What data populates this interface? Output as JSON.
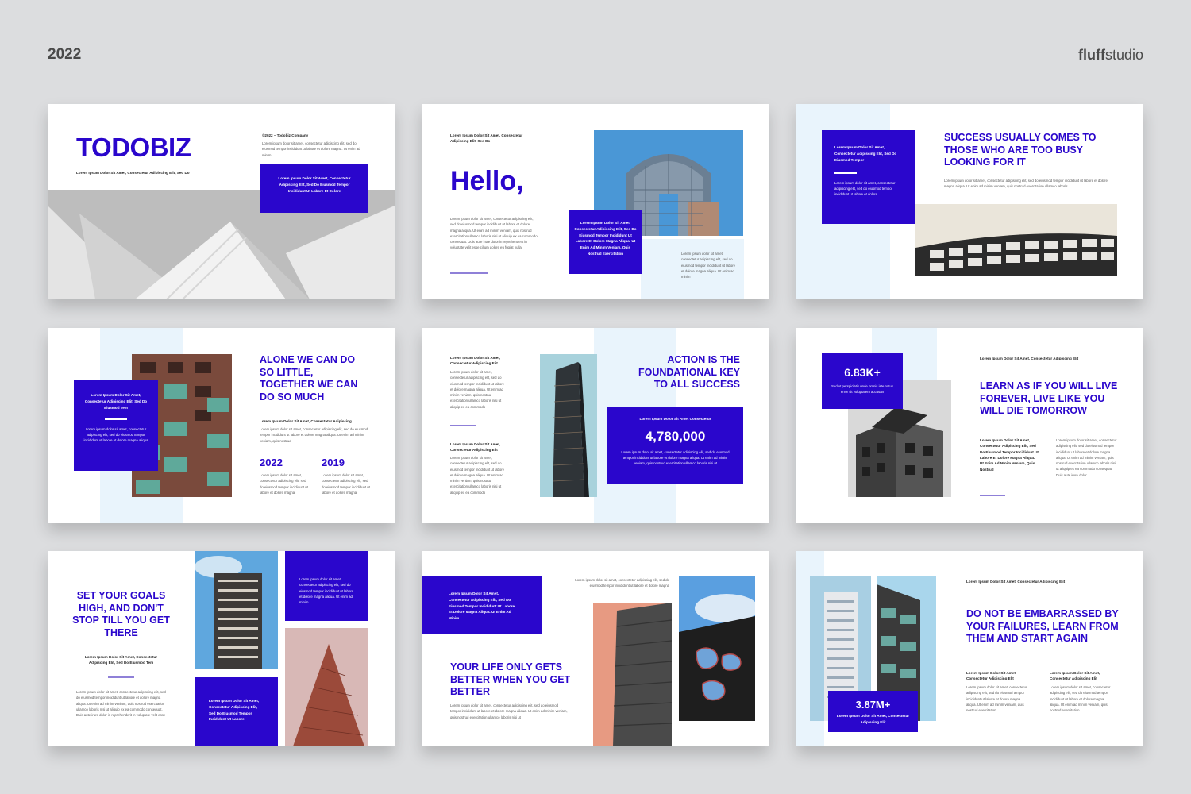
{
  "header": {
    "year": "2022",
    "brand_bold": "fluff",
    "brand_light": "studio"
  },
  "colors": {
    "accent": "#2a06cc",
    "tint": "#e9f4fc",
    "background": "#dcdddf"
  },
  "slides": {
    "s1": {
      "title": "TODOBIZ",
      "subtitle": "Lorem Ipsum Dolor Sit Amet, Consectetur Adipiscing Elit, Sed Do",
      "copyright": "©2022 – Todobiz Company",
      "body": "Lorem ipsum dolor sit amet, consectetur adipiscing elit, sed do eiusmod tempor incididunt ut labore et dolore magna. Ut enim ad minim",
      "box": "Lorem Ipsum Dolor Sit Amet, Consectetur Adipiscing Elit, Sed Do Eiusmod Tempor Incididunt Ut Labore Et Dolore"
    },
    "s2": {
      "kicker": "Lorem Ipsum Dolor Sit Amet, Consectetur Adipiscing Elit, Sed Do",
      "title": "Hello,",
      "body": "Lorem ipsum dolor sit amet, consectetur adipiscing elit, sed do eiusmod tempor incididunt ut labore et dolore magna aliqua. Ut enim ad minim veniam, quis nostrud exercitation ullamco laboris nisi ut aliquip ex ea commodo consequat. Duis aute irure dolor in reprehenderit in voluptate velit esse cillum dolore eu fugiat nulla.",
      "box": "Lorem Ipsum Dolor Sit Amet, Consectetur Adipiscing Elit, Sed Do Eiusmod Tempor Incididunt Ut Labore Et Dolore Magna Aliqua. Ut Enim Ad Minim Veniam, Quis Nostrud Exercitation",
      "side": "Lorem ipsum dolor sit amet, consectetur adipiscing elit, sed do eiusmod tempor incididunt ut labore et dolore magna aliqua. Ut enim ad minim"
    },
    "s3": {
      "box_title": "Lorem Ipsum Dolor Sit Amet, Consectetur Adipiscing Elit, Sed Do Eiusmod Tempor",
      "box_body": "Lorem ipsum dolor sit amet, consectetur adipiscing elit, sed do eiusmod tempor incididunt ut labore et dolore",
      "title": "SUCCESS USUALLY COMES TO THOSE WHO ARE TOO BUSY LOOKING FOR IT",
      "body": "Lorem ipsum dolor sit amet, consectetur adipiscing elit, sed do eiusmod tempor incididunt ut labore et dolore magna aliqua. Ut enim ad minim veniam, quis nostrud exercitation ullamco laboris"
    },
    "s4": {
      "box_title": "Lorem Ipsum Dolor Sit Amet, Consectetur Adipiscing Elit, Sed Do Eiusmod Tem",
      "box_body": "Lorem ipsum dolor sit amet, consectetur adipiscing elit, sed do eiusmod tempor incididunt ut labore et dolore magna aliqua",
      "title": "ALONE WE CAN DO SO LITTLE, TOGETHER WE CAN DO SO MUCH",
      "kicker": "Lorem Ipsum Dolor Sit Amet, Consectetur Adipiscing",
      "body": "Lorem ipsum dolor sit amet, consectetur adipiscing elit, sed do eiusmod tempor incididunt ut labore et dolore magna aliqua. Ut enim ad minim veniam, quis nostrud",
      "year1": "2022",
      "year2": "2019",
      "col1": "Lorem ipsum dolor sit amet, consectetur adipiscing elit, sed do eiusmod tempor incididunt ut labore et dolore magna",
      "col2": "Lorem ipsum dolor sit amet, consectetur adipiscing elit, sed do eiusmod tempor incididunt ut labore et dolore magna"
    },
    "s5": {
      "kicker1": "Lorem Ipsum Dolor Sit Amet, Consectetur Adipiscing Elit",
      "body1": "Lorem ipsum dolor sit amet, consectetur adipiscing elit, sed do eiusmod tempor incididunt ut labore et dolore magna aliqua. Ut enim ad minim veniam, quis nostrud exercitation ullamco laboris nisi ut aliquip ex ea commodo",
      "kicker2": "Lorem Ipsum Dolor Sit Amet, Consectetur Adipiscing Elit",
      "body2": "Lorem ipsum dolor sit amet, consectetur adipiscing elit, sed do eiusmod tempor incididunt ut labore et dolore magna aliqua. Ut enim ad minim veniam, quis nostrud exercitation ullamco laboris nisi ut aliquip ex ea commodo",
      "title": "ACTION IS THE FOUNDATIONAL KEY TO ALL SUCCESS",
      "box_kicker": "Lorem Ipsum Dolor Sit Amet Consectetur",
      "stat": "4,780,000",
      "box_body": "Lorem ipsum dolor sit amet, consectetur adipiscing elit, sed do eiusmod tempor incididunt ut labore et dolore magna aliqua. Ut enim ad minim veniam, quis nostrud exercitation ullamco laboris nisi ut"
    },
    "s6": {
      "stat": "6.83K+",
      "stat_caption": "Sed ut perspiciatis unde omnis iste natus error sit voluptatem accusan",
      "kicker": "Lorem Ipsum Dolor Sit Amet, Consectetur Adipiscing Elit",
      "title": "LEARN AS IF YOU WILL LIVE FOREVER, LIVE LIKE YOU WILL DIE TOMORROW",
      "col1": "Lorem Ipsum Dolor Sit Amet, Consectetur Adipiscing Elit, Sed Do Eiusmod Tempor Incididunt Ut Labore Et Dolore Magna Aliqua. Ut Enim Ad Minim Veniam, Quis Nostrud",
      "col2": "Lorem ipsum dolor sit amet, consectetur adipiscing elit, sed do eiusmod tempor incididunt ut labore et dolore magna aliqua. Ut enim ad minim veniam, quis nostrud exercitation ullamco laboris nisi ut aliquip ex ea commodo consequat. Duis aute irure dolor"
    },
    "s7": {
      "title": "SET YOUR GOALS HIGH, AND DON'T STOP TILL YOU GET THERE",
      "kicker": "Lorem Ipsum Dolor Sit Amet, Consectetur Adipiscing Elit, Sed Do Eiusmod Tem",
      "body": "Lorem ipsum dolor sit amet, consectetur adipiscing elit, sed do eiusmod tempor incididunt ut labore et dolore magna aliqua. Ut enim ad minim veniam, quis nostrud exercitation ullamco laboris nisi ut aliquip ex ea commodo consequat. Duis aute irure dolor in reprehenderit in voluptate velit esse",
      "box1": "Lorem ipsum dolor sit amet, consectetur adipiscing elit, sed do eiusmod tempor incididunt ut labore et dolore magna aliqua. Ut enim ad minim",
      "box2": "Lorem Ipsum Dolor Sit Amet, Consectetur Adipiscing Elit, Sed Do Eiusmod Tempor Incididunt Ut Labore"
    },
    "s8": {
      "box": "Lorem Ipsum Dolor Sit Amet, Consectetur Adipiscing Elit, Sed Do Eiusmod Tempor Incididunt Ut Labore Et Dolore Magna Aliqua. Ut Enim Ad Minim",
      "top_body": "Lorem ipsum dolor sit amet, consectetur adipiscing elit, sed do eiusmod tempor incididunt ut labore et dolore magna",
      "title": "YOUR LIFE ONLY GETS BETTER WHEN YOU GET BETTER",
      "body": "Lorem ipsum dolor sit amet, consectetur adipiscing elit, sed do eiusmod tempor incididunt ut labore et dolore magna aliqua. Ut enim ad minim veniam, quis nostrud exercitation ullamco laboris nisi ut"
    },
    "s9": {
      "kicker": "Lorem Ipsum Dolor Sit Amet, Consectetur Adipiscing Elit",
      "title": "DO NOT BE EMBARRASSED BY YOUR FAILURES, LEARN FROM THEM AND START AGAIN",
      "stat": "3.87M+",
      "stat_caption": "Lorem Ipsum Dolor Sit Amet, Consectetur Adipiscing Elit",
      "col1_kicker": "Lorem Ipsum Dolor Sit Amet, Consectetur Adipiscing Elit",
      "col1_body": "Lorem ipsum dolor sit amet, consectetur adipiscing elit, sed do eiusmod tempor incididunt ut labore et dolore magna aliqua. Ut enim ad minim veniam, quis nostrud exercitation",
      "col2_kicker": "Lorem Ipsum Dolor Sit Amet, Consectetur Adipiscing Elit",
      "col2_body": "Lorem ipsum dolor sit amet, consectetur adipiscing elit, sed do eiusmod tempor incididunt ut labore et dolore magna aliqua. Ut enim ad minim veniam, quis nostrud exercitation"
    }
  }
}
